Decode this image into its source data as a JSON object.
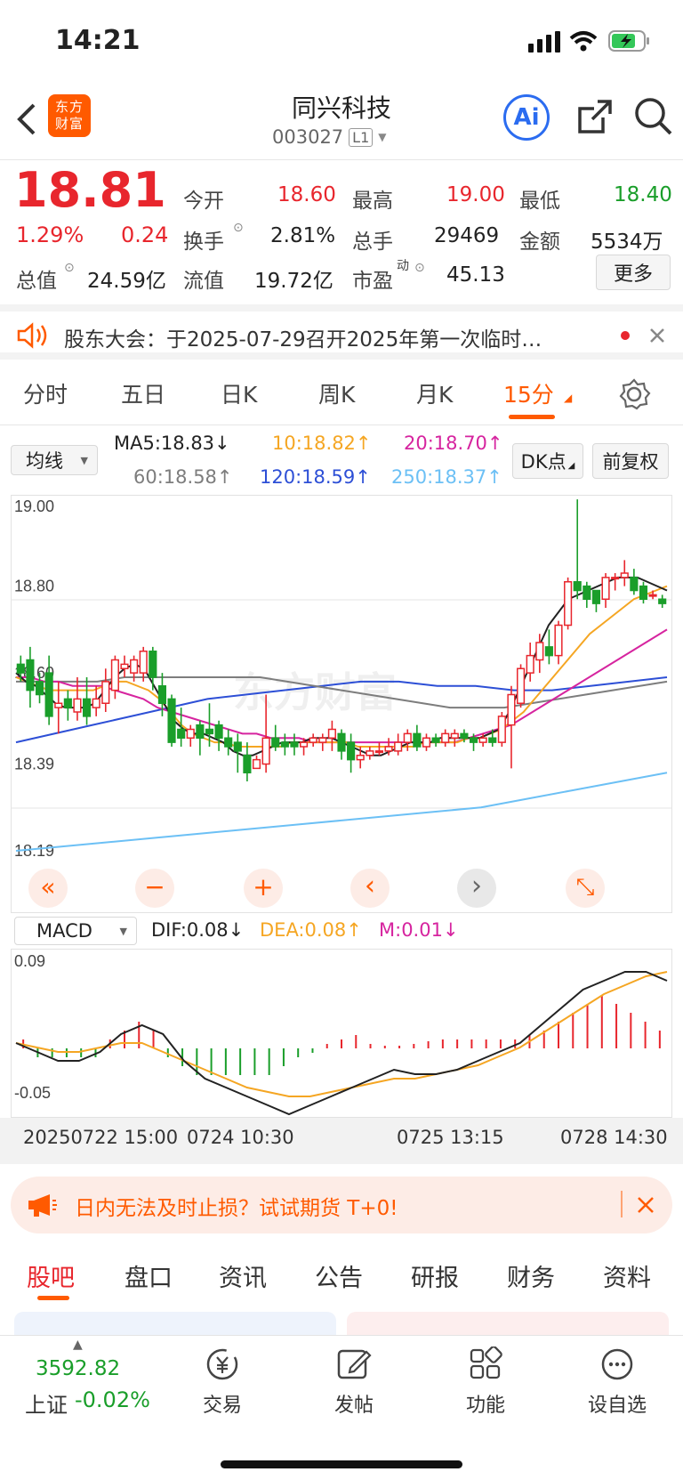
{
  "status": {
    "time": "14:21"
  },
  "header": {
    "title": "同兴科技",
    "code": "003027",
    "level": "L1",
    "logo_text": "东方财富",
    "ai_label": "Ai"
  },
  "quote": {
    "price": "18.81",
    "pct": "1.29%",
    "change": "0.24",
    "open_label": "今开",
    "open": "18.60",
    "high_label": "最高",
    "high": "19.00",
    "low_label": "最低",
    "low": "18.40",
    "turnover_label": "换手",
    "turnover": "2.81%",
    "volume_label": "总手",
    "volume": "29469",
    "amount_label": "金额",
    "amount": "5534万",
    "mktcap_label": "总值",
    "mktcap": "24.59亿",
    "float_label": "流值",
    "float": "19.72亿",
    "pe_label": "市盈",
    "pe_sup": "动",
    "pe": "45.13",
    "more": "更多"
  },
  "notice": {
    "text": "股东大会：于2025-07-29召开2025年第一次临时…"
  },
  "chart_tabs": [
    {
      "label": "分时"
    },
    {
      "label": "五日"
    },
    {
      "label": "日K"
    },
    {
      "label": "周K"
    },
    {
      "label": "月K"
    },
    {
      "label": "15分",
      "active": true
    }
  ],
  "indicators": {
    "ma_select": "均线",
    "ma5": "MA5:18.83↓",
    "ma10": "10:18.82↑",
    "ma20": "20:18.70↑",
    "ma60": "60:18.58↑",
    "ma120": "120:18.59↑",
    "ma250": "250:18.37↑",
    "dk_label": "DK点",
    "adjust_label": "前复权",
    "macd_select": "MACD",
    "dif": "DIF:0.08↓",
    "dea": "DEA:0.08↑",
    "m": "M:0.01↓"
  },
  "colors": {
    "up": "#e8262d",
    "down": "#1a9e2a",
    "ma5": "#222222",
    "ma10": "#f5a623",
    "ma20": "#d6249f",
    "ma60": "#7d7d7d",
    "ma120": "#2d4fd6",
    "ma250": "#6cc0f5",
    "accent": "#ff5a00"
  },
  "chart_data": {
    "type": "candlestick",
    "y_tick_labels": [
      "19.00",
      "18.80",
      "18.60",
      "18.39",
      "18.19"
    ],
    "macd_tick_labels": [
      "0.09",
      "-0.05"
    ],
    "x_tick_labels": [
      "20250722 15:00",
      "0724 10:30",
      "0725 13:15",
      "0728 14:30"
    ],
    "ylim": [
      18.19,
      19.0
    ],
    "candles": [
      {
        "o": 18.62,
        "h": 18.64,
        "c": 18.6,
        "l": 18.58
      },
      {
        "o": 18.63,
        "h": 18.66,
        "c": 18.56,
        "l": 18.52
      },
      {
        "o": 18.58,
        "h": 18.6,
        "c": 18.55,
        "l": 18.53
      },
      {
        "o": 18.6,
        "h": 18.64,
        "c": 18.5,
        "l": 18.48
      },
      {
        "o": 18.52,
        "h": 18.58,
        "c": 18.53,
        "l": 18.46
      },
      {
        "o": 18.54,
        "h": 18.56,
        "c": 18.52,
        "l": 18.49
      },
      {
        "o": 18.51,
        "h": 18.59,
        "c": 18.54,
        "l": 18.49
      },
      {
        "o": 18.54,
        "h": 18.59,
        "c": 18.5,
        "l": 18.48
      },
      {
        "o": 18.52,
        "h": 18.57,
        "c": 18.54,
        "l": 18.5
      },
      {
        "o": 18.53,
        "h": 18.61,
        "c": 18.58,
        "l": 18.51
      },
      {
        "o": 18.56,
        "h": 18.64,
        "c": 18.63,
        "l": 18.54
      },
      {
        "o": 18.61,
        "h": 18.64,
        "c": 18.62,
        "l": 18.59
      },
      {
        "o": 18.6,
        "h": 18.64,
        "c": 18.63,
        "l": 18.58
      },
      {
        "o": 18.6,
        "h": 18.66,
        "c": 18.65,
        "l": 18.58
      },
      {
        "o": 18.65,
        "h": 18.66,
        "c": 18.59,
        "l": 18.56
      },
      {
        "o": 18.57,
        "h": 18.6,
        "c": 18.53,
        "l": 18.5
      },
      {
        "o": 18.54,
        "h": 18.55,
        "c": 18.44,
        "l": 18.43
      },
      {
        "o": 18.47,
        "h": 18.52,
        "c": 18.45,
        "l": 18.43
      },
      {
        "o": 18.45,
        "h": 18.48,
        "c": 18.47,
        "l": 18.43
      },
      {
        "o": 18.48,
        "h": 18.49,
        "c": 18.45,
        "l": 18.41
      },
      {
        "o": 18.47,
        "h": 18.53,
        "c": 18.46,
        "l": 18.43
      },
      {
        "o": 18.48,
        "h": 18.49,
        "c": 18.45,
        "l": 18.42
      },
      {
        "o": 18.45,
        "h": 18.47,
        "c": 18.43,
        "l": 18.41
      },
      {
        "o": 18.44,
        "h": 18.46,
        "c": 18.42,
        "l": 18.37
      },
      {
        "o": 18.41,
        "h": 18.44,
        "c": 18.37,
        "l": 18.35
      },
      {
        "o": 18.38,
        "h": 18.41,
        "c": 18.4,
        "l": 18.38
      },
      {
        "o": 18.39,
        "h": 18.55,
        "c": 18.45,
        "l": 18.37
      },
      {
        "o": 18.45,
        "h": 18.48,
        "c": 18.43,
        "l": 18.42
      },
      {
        "o": 18.44,
        "h": 18.46,
        "c": 18.43,
        "l": 18.41
      },
      {
        "o": 18.44,
        "h": 18.46,
        "c": 18.43,
        "l": 18.41
      },
      {
        "o": 18.43,
        "h": 18.45,
        "c": 18.44,
        "l": 18.41
      },
      {
        "o": 18.44,
        "h": 18.46,
        "c": 18.45,
        "l": 18.43
      },
      {
        "o": 18.44,
        "h": 18.46,
        "c": 18.45,
        "l": 18.42
      },
      {
        "o": 18.45,
        "h": 18.49,
        "c": 18.47,
        "l": 18.42
      },
      {
        "o": 18.46,
        "h": 18.47,
        "c": 18.42,
        "l": 18.4
      },
      {
        "o": 18.44,
        "h": 18.46,
        "c": 18.4,
        "l": 18.37
      },
      {
        "o": 18.4,
        "h": 18.43,
        "c": 18.41,
        "l": 18.38
      },
      {
        "o": 18.41,
        "h": 18.43,
        "c": 18.42,
        "l": 18.4
      },
      {
        "o": 18.42,
        "h": 18.44,
        "c": 18.42,
        "l": 18.41
      },
      {
        "o": 18.42,
        "h": 18.45,
        "c": 18.43,
        "l": 18.41
      },
      {
        "o": 18.42,
        "h": 18.46,
        "c": 18.44,
        "l": 18.41
      },
      {
        "o": 18.44,
        "h": 18.47,
        "c": 18.46,
        "l": 18.42
      },
      {
        "o": 18.46,
        "h": 18.48,
        "c": 18.43,
        "l": 18.42
      },
      {
        "o": 18.43,
        "h": 18.46,
        "c": 18.45,
        "l": 18.42
      },
      {
        "o": 18.45,
        "h": 18.46,
        "c": 18.44,
        "l": 18.43
      },
      {
        "o": 18.44,
        "h": 18.47,
        "c": 18.46,
        "l": 18.43
      },
      {
        "o": 18.45,
        "h": 18.47,
        "c": 18.46,
        "l": 18.43
      },
      {
        "o": 18.46,
        "h": 18.47,
        "c": 18.45,
        "l": 18.44
      },
      {
        "o": 18.45,
        "h": 18.46,
        "c": 18.44,
        "l": 18.42
      },
      {
        "o": 18.44,
        "h": 18.46,
        "c": 18.45,
        "l": 18.43
      },
      {
        "o": 18.45,
        "h": 18.47,
        "c": 18.44,
        "l": 18.43
      },
      {
        "o": 18.44,
        "h": 18.51,
        "c": 18.5,
        "l": 18.43
      },
      {
        "o": 18.48,
        "h": 18.57,
        "c": 18.55,
        "l": 18.38
      },
      {
        "o": 18.53,
        "h": 18.62,
        "c": 18.61,
        "l": 18.52
      },
      {
        "o": 18.6,
        "h": 18.67,
        "c": 18.64,
        "l": 18.58
      },
      {
        "o": 18.63,
        "h": 18.69,
        "c": 18.67,
        "l": 18.6
      },
      {
        "o": 18.66,
        "h": 18.7,
        "c": 18.64,
        "l": 18.62
      },
      {
        "o": 18.64,
        "h": 18.72,
        "c": 18.71,
        "l": 18.62
      },
      {
        "o": 18.71,
        "h": 18.82,
        "c": 18.81,
        "l": 18.7
      },
      {
        "o": 18.81,
        "h": 19.0,
        "c": 18.79,
        "l": 18.77
      },
      {
        "o": 18.8,
        "h": 18.81,
        "c": 18.77,
        "l": 18.75
      },
      {
        "o": 18.79,
        "h": 18.79,
        "c": 18.76,
        "l": 18.74
      },
      {
        "o": 18.77,
        "h": 18.83,
        "c": 18.82,
        "l": 18.75
      },
      {
        "o": 18.82,
        "h": 18.83,
        "c": 18.82,
        "l": 18.79
      },
      {
        "o": 18.82,
        "h": 18.86,
        "c": 18.83,
        "l": 18.8
      },
      {
        "o": 18.82,
        "h": 18.84,
        "c": 18.79,
        "l": 18.78
      },
      {
        "o": 18.8,
        "h": 18.81,
        "c": 18.77,
        "l": 18.76
      },
      {
        "o": 18.78,
        "h": 18.79,
        "c": 18.78,
        "l": 18.77
      },
      {
        "o": 18.77,
        "h": 18.78,
        "c": 18.76,
        "l": 18.75
      }
    ],
    "ma5": [
      18.6,
      18.58,
      18.57,
      18.55,
      18.53,
      18.52,
      18.52,
      18.52,
      18.53,
      18.56,
      18.59,
      18.61,
      18.62,
      18.61,
      18.57,
      18.53,
      18.49,
      18.47,
      18.46,
      18.46,
      18.45,
      18.44,
      18.42,
      18.41,
      18.41,
      18.42,
      18.43,
      18.44,
      18.44,
      18.44,
      18.45,
      18.45,
      18.45,
      18.44,
      18.43,
      18.42,
      18.41,
      18.41,
      18.42,
      18.43,
      18.44,
      18.44,
      18.44,
      18.45,
      18.45,
      18.45,
      18.45,
      18.45,
      18.46,
      18.47,
      18.51,
      18.56,
      18.61,
      18.66,
      18.71,
      18.74,
      18.77,
      18.78,
      18.79,
      18.8,
      18.81,
      18.82,
      18.82,
      18.82,
      18.81,
      18.8,
      18.79
    ],
    "ma10": [
      18.59,
      18.58,
      18.57,
      18.56,
      18.56,
      18.56,
      18.56,
      18.56,
      18.57,
      18.58,
      18.58,
      18.57,
      18.56,
      18.54,
      18.51,
      18.48,
      18.46,
      18.45,
      18.44,
      18.44,
      18.43,
      18.43,
      18.43,
      18.43,
      18.43,
      18.44,
      18.44,
      18.44,
      18.44,
      18.44,
      18.44,
      18.43,
      18.43,
      18.43,
      18.43,
      18.43,
      18.43,
      18.44,
      18.44,
      18.44,
      18.44,
      18.45,
      18.45,
      18.46,
      18.47,
      18.49,
      18.51,
      18.54,
      18.57,
      18.6,
      18.63,
      18.66,
      18.69,
      18.71,
      18.73,
      18.75,
      18.77,
      18.78,
      18.79,
      18.8
    ],
    "ma20": [
      18.59,
      18.59,
      18.58,
      18.58,
      18.57,
      18.57,
      18.57,
      18.56,
      18.55,
      18.54,
      18.52,
      18.51,
      18.5,
      18.49,
      18.48,
      18.47,
      18.46,
      18.46,
      18.45,
      18.45,
      18.45,
      18.44,
      18.44,
      18.44,
      18.44,
      18.44,
      18.44,
      18.44,
      18.44,
      18.44,
      18.44,
      18.44,
      18.45,
      18.46,
      18.47,
      18.48,
      18.5,
      18.52,
      18.54,
      18.56,
      18.58,
      18.6,
      18.62,
      18.64,
      18.66,
      18.68,
      18.7
    ],
    "ma60": [
      18.58,
      18.58,
      18.58,
      18.58,
      18.59,
      18.59,
      18.59,
      18.59,
      18.59,
      18.59,
      18.58,
      18.57,
      18.56,
      18.55,
      18.54,
      18.53,
      18.52,
      18.52,
      18.52,
      18.53,
      18.54,
      18.55,
      18.56,
      18.57,
      18.58
    ],
    "ma120": [
      18.44,
      18.46,
      18.48,
      18.5,
      18.52,
      18.54,
      18.55,
      18.56,
      18.57,
      18.58,
      18.58,
      18.57,
      18.57,
      18.56,
      18.56,
      18.57,
      18.58,
      18.59
    ],
    "ma250": [
      18.19,
      18.2,
      18.21,
      18.22,
      18.23,
      18.24,
      18.25,
      18.26,
      18.27,
      18.28,
      18.29,
      18.31,
      18.33,
      18.35,
      18.37
    ],
    "macd_hist": [
      0.01,
      -0.01,
      -0.01,
      -0.01,
      -0.01,
      -0.01,
      0.01,
      0.02,
      0.03,
      0.02,
      -0.01,
      -0.02,
      -0.03,
      -0.03,
      -0.03,
      -0.03,
      -0.03,
      -0.03,
      -0.02,
      -0.01,
      -0.005,
      0.005,
      0.01,
      0.015,
      0.005,
      0.003,
      0.003,
      0.005,
      0.008,
      0.01,
      0.01,
      0.01,
      0.01,
      0.01,
      0.01,
      0.015,
      0.02,
      0.03,
      0.04,
      0.05,
      0.06,
      0.05,
      0.04,
      0.03,
      0.02
    ],
    "dif": [
      0.0,
      -0.01,
      -0.02,
      -0.02,
      -0.01,
      0.01,
      0.02,
      0.01,
      -0.02,
      -0.04,
      -0.05,
      -0.06,
      -0.07,
      -0.08,
      -0.07,
      -0.06,
      -0.05,
      -0.04,
      -0.03,
      -0.035,
      -0.035,
      -0.03,
      -0.02,
      -0.01,
      0.0,
      0.02,
      0.04,
      0.06,
      0.07,
      0.08,
      0.08,
      0.07
    ],
    "dea": [
      0.0,
      -0.005,
      -0.01,
      -0.01,
      -0.005,
      0.0,
      0.0,
      -0.01,
      -0.02,
      -0.03,
      -0.04,
      -0.05,
      -0.055,
      -0.06,
      -0.06,
      -0.055,
      -0.05,
      -0.045,
      -0.04,
      -0.04,
      -0.035,
      -0.03,
      -0.025,
      -0.015,
      -0.005,
      0.01,
      0.025,
      0.04,
      0.055,
      0.065,
      0.075,
      0.08
    ]
  },
  "chart_controls": {
    "left_fast": "«",
    "zoom_out": "−",
    "zoom_in": "+",
    "prev": "‹",
    "next": "›",
    "fullscreen": "⤡"
  },
  "watermark": "东方财富",
  "ad": {
    "text": "日内无法及时止损？试试期货 T+0!"
  },
  "bottom_tabs": [
    {
      "label": "股吧",
      "active": true
    },
    {
      "label": "盘口"
    },
    {
      "label": "资讯"
    },
    {
      "label": "公告"
    },
    {
      "label": "研报"
    },
    {
      "label": "财务"
    },
    {
      "label": "资料"
    }
  ],
  "footer": {
    "index_value": "3592.82",
    "index_name": "上证",
    "index_pct": "-0.02%",
    "items": [
      {
        "label": "交易"
      },
      {
        "label": "发帖"
      },
      {
        "label": "功能"
      },
      {
        "label": "设自选"
      }
    ]
  }
}
